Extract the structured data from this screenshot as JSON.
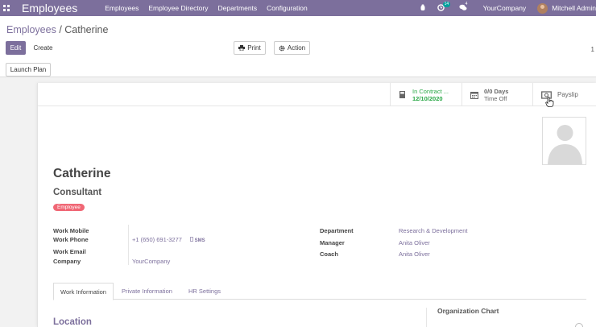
{
  "navbar": {
    "app_name": "Employees",
    "menu": [
      "Employees",
      "Employee Directory",
      "Departments",
      "Configuration"
    ],
    "activity_count": "14",
    "message_count": "4",
    "company": "YourCompany",
    "user": "Mitchell Admin"
  },
  "control_panel": {
    "breadcrumb_parent": "Employees",
    "breadcrumb_sep": " / ",
    "breadcrumb_current": "Catherine",
    "edit_label": "Edit",
    "create_label": "Create",
    "print_label": "Print",
    "action_label": "Action",
    "pager": "1",
    "launch_plan_label": "Launch Plan"
  },
  "stats": {
    "contract_label": "In Contract ...",
    "contract_date": "12/10/2020",
    "timeoff_value": "0/0 Days",
    "timeoff_label": "Time Off",
    "payslip_label": "Payslip"
  },
  "employee": {
    "name": "Catherine",
    "job_title": "Consultant",
    "tag": "Employee"
  },
  "fields": {
    "work_mobile_label": "Work Mobile",
    "work_mobile_value": "",
    "work_phone_label": "Work Phone",
    "work_phone_value": "+1 (650) 691-3277",
    "sms_label": "SMS",
    "work_email_label": "Work Email",
    "work_email_value": "",
    "company_label": "Company",
    "company_value": "YourCompany",
    "department_label": "Department",
    "department_value": "Research & Development",
    "manager_label": "Manager",
    "manager_value": "Anita Oliver",
    "coach_label": "Coach",
    "coach_value": "Anita Oliver"
  },
  "tabs": [
    "Work Information",
    "Private Information",
    "HR Settings"
  ],
  "work_info": {
    "location_title": "Location",
    "org_chart_title": "Organization Chart"
  },
  "colors": {
    "brand": "#7c6f9c",
    "tag_red": "#f06775",
    "status_green": "#28a745",
    "badge_teal": "#00a09d"
  }
}
